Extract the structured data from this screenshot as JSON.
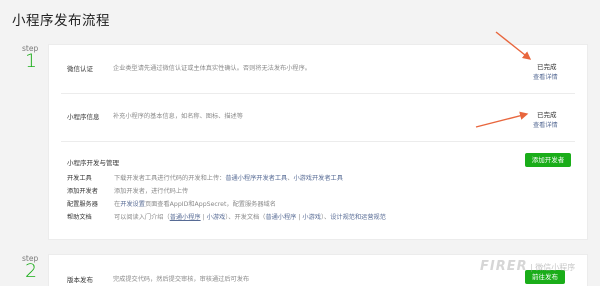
{
  "page_title": "小程序发布流程",
  "steps": [
    {
      "label": "step",
      "number": "1"
    },
    {
      "label": "step",
      "number": "2"
    }
  ],
  "card1": {
    "verify": {
      "title": "微信认证",
      "desc": "企业类型请先通过微信认证或主体真实性确认。否则将无法发布小程序。",
      "status": "已完成",
      "link": "查看详情"
    },
    "info": {
      "title": "小程序信息",
      "desc": "补充小程序的基本信息，如名称、图标、描述等",
      "status": "已完成",
      "link": "查看详情"
    },
    "mgmt": {
      "title": "小程序开发与管理",
      "button": "添加开发者",
      "rows": [
        {
          "key": "开发工具",
          "text1": "下载开发者工具进行代码的开发和上传：",
          "link1": "普通小程序开发者工具",
          "sep": "、",
          "link2": "小游戏开发者工具"
        },
        {
          "key": "添加开发者",
          "text1": "添加开发者，进行代码上传"
        },
        {
          "key": "配置服务器",
          "text1": "在",
          "link1": "开发设置",
          "text2": "页面查看AppID和AppSecret，配置服务器域名"
        },
        {
          "key": "帮助文档",
          "text1": "可以阅读入门介绍（",
          "link1": "普通小程序",
          "sep1": " | ",
          "link2": "小游戏",
          "text2": "）、开发文档（",
          "link3": "普通小程序",
          "sep2": " | ",
          "link4": "小游戏",
          "text3": "）、",
          "link5": "设计规范和运营规范"
        }
      ]
    }
  },
  "card2": {
    "title": "版本发布",
    "desc": "完成提交代码，然后提交审核，审核通过后可发布",
    "button": "前往发布"
  },
  "watermark": {
    "text": "FIRER",
    "sub": "| 微信小程序"
  },
  "colors": {
    "accent": "#1aad19",
    "link": "#576b95",
    "arrow": "#e8663d"
  }
}
